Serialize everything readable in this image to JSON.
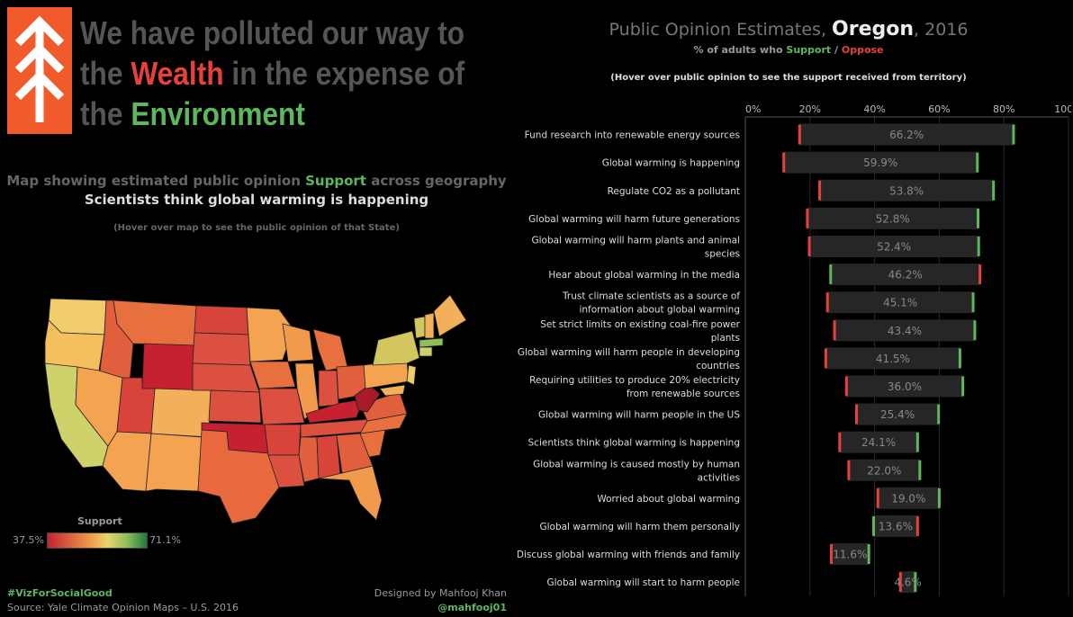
{
  "headline": {
    "line1": "We have polluted our way to",
    "line2_prefix": "the ",
    "line2_highlight": "Wealth",
    "line2_suffix": " in the expense of",
    "line3_prefix": "the ",
    "line3_highlight": "Environment"
  },
  "map": {
    "subtitle_prefix": "Map showing estimated public opinion ",
    "subtitle_highlight": "Support",
    "subtitle_suffix": " across geography",
    "question": "Scientists think global warming is happening",
    "hover_note": "(Hover over map to see the public opinion of that State)",
    "legend": {
      "title": "Support",
      "min": "37.5%",
      "max": "71.1%"
    }
  },
  "footer": {
    "hashtag": "#VizForSocialGood",
    "source": "Source: Yale Climate Opinion Maps – U.S. 2016",
    "designed_by": "Designed by Mahfooj Khan",
    "handle": "@mahfooj01"
  },
  "chart_header": {
    "title_prefix": "Public Opinion Estimates, ",
    "state": "Oregon",
    "title_suffix": ", 2016",
    "sub_prefix": "% of adults who ",
    "sub_support": "Support",
    "sub_sep": " / ",
    "sub_oppose": "Oppose",
    "hover_note": "(Hover over public opinion to see the support received from territory)"
  },
  "colors": {
    "support": "#5cb85c",
    "oppose": "#e8403a",
    "bar": "#262626",
    "logo": "#f15a2b"
  },
  "chart_data": {
    "type": "bar",
    "orientation": "horizontal",
    "x_ticks": [
      "0%",
      "20%",
      "40%",
      "60%",
      "80%",
      "100%"
    ],
    "xlim": [
      0,
      100
    ],
    "legend": "none",
    "rows": [
      {
        "label": [
          "Fund research into renewable energy sources"
        ],
        "support": 83.0,
        "oppose": 16.8,
        "gap_label": "66.2%"
      },
      {
        "label": [
          "Global warming is happening"
        ],
        "support": 71.8,
        "oppose": 11.9,
        "gap_label": "59.9%"
      },
      {
        "label": [
          "Regulate CO2 as a pollutant"
        ],
        "support": 76.8,
        "oppose": 23.0,
        "gap_label": "53.8%"
      },
      {
        "label": [
          "Global warming will harm future generations"
        ],
        "support": 72.0,
        "oppose": 19.2,
        "gap_label": "52.8%"
      },
      {
        "label": [
          "Global warming will harm plants and animal",
          "species"
        ],
        "support": 72.2,
        "oppose": 19.8,
        "gap_label": "52.4%"
      },
      {
        "label": [
          "Hear about global warming in the media"
        ],
        "support": 26.4,
        "oppose": 72.6,
        "gap_label": "46.2%"
      },
      {
        "label": [
          "Trust climate scientists as a source of",
          "information about global warming"
        ],
        "support": 70.5,
        "oppose": 25.4,
        "gap_label": "45.1%"
      },
      {
        "label": [
          "Set strict limits on existing coal-fire power",
          "plants"
        ],
        "support": 71.0,
        "oppose": 27.6,
        "gap_label": "43.4%"
      },
      {
        "label": [
          "Global warming will harm people in developing",
          "countries"
        ],
        "support": 66.4,
        "oppose": 24.9,
        "gap_label": "41.5%"
      },
      {
        "label": [
          "Requiring utilities to produce 20% electricity",
          "from renewable sources"
        ],
        "support": 67.3,
        "oppose": 31.3,
        "gap_label": "36.0%"
      },
      {
        "label": [
          "Global warming will harm people in the US"
        ],
        "support": 59.8,
        "oppose": 34.4,
        "gap_label": "25.4%"
      },
      {
        "label": [
          "Scientists think global warming is happening"
        ],
        "support": 53.3,
        "oppose": 29.2,
        "gap_label": "24.1%"
      },
      {
        "label": [
          "Global warming is caused mostly by human",
          "activities"
        ],
        "support": 54.0,
        "oppose": 32.0,
        "gap_label": "22.0%"
      },
      {
        "label": [
          "Worried about global warming"
        ],
        "support": 60.0,
        "oppose": 41.0,
        "gap_label": "19.0%"
      },
      {
        "label": [
          "Global warming will harm them personally"
        ],
        "support": 39.7,
        "oppose": 53.3,
        "gap_label": "13.6%"
      },
      {
        "label": [
          "Discuss global warming with friends and family"
        ],
        "support": 38.2,
        "oppose": 26.6,
        "gap_label": "11.6%"
      },
      {
        "label": [
          "Global warming will start to harm people"
        ],
        "support": 52.6,
        "oppose": 48.0,
        "gap_label": "4.6%"
      }
    ]
  }
}
